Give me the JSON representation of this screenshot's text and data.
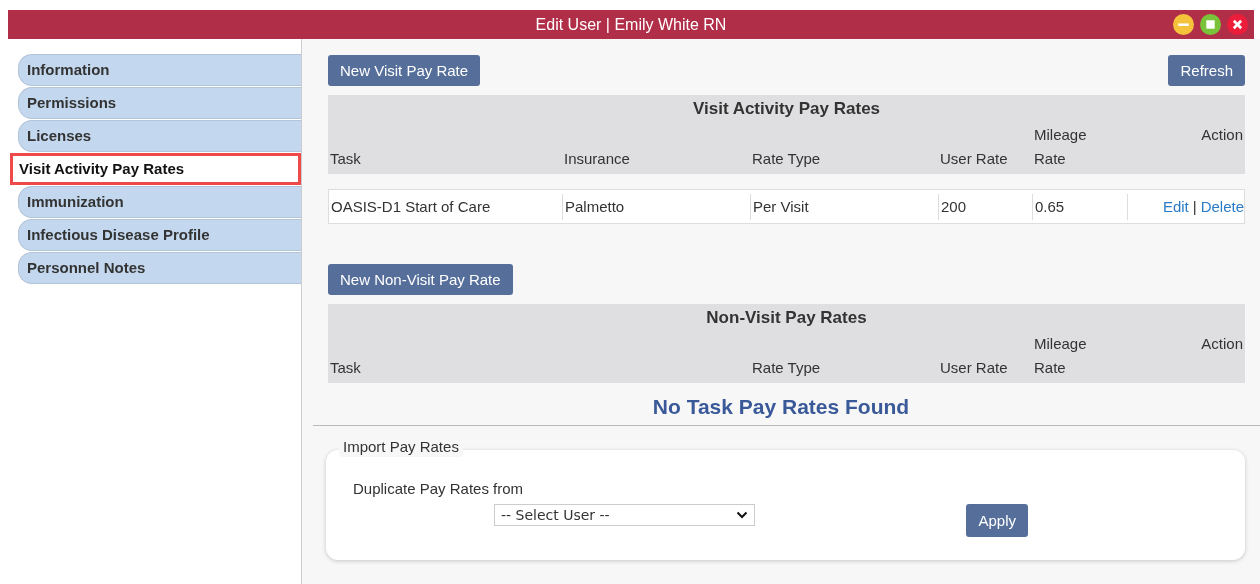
{
  "window": {
    "title": "Edit User | Emily White RN"
  },
  "sidebar": {
    "items": [
      {
        "label": "Information",
        "selected": false
      },
      {
        "label": "Permissions",
        "selected": false
      },
      {
        "label": "Licenses",
        "selected": false
      },
      {
        "label": "Visit Activity Pay Rates",
        "selected": true
      },
      {
        "label": "Immunization",
        "selected": false
      },
      {
        "label": "Infectious Disease Profile",
        "selected": false
      },
      {
        "label": "Personnel Notes",
        "selected": false
      }
    ]
  },
  "toolbar": {
    "new_button": "New Visit Pay Rate",
    "refresh_button": "Refresh"
  },
  "visit_table": {
    "title": "Visit Activity Pay Rates",
    "columns": [
      {
        "label": "Task",
        "kind": "task"
      },
      {
        "label": "Insurance",
        "kind": "insurance"
      },
      {
        "label": "Rate Type",
        "kind": "rate_type"
      },
      {
        "label": "User Rate",
        "kind": "user_rate"
      },
      {
        "label": "Mileage Rate",
        "kind": "mileage"
      },
      {
        "label": "Action",
        "kind": "action"
      }
    ],
    "rows": [
      {
        "cells": [
          "OASIS-D1 Start of Care",
          "Palmetto",
          "Per Visit",
          "200",
          "0.65"
        ],
        "actions": [
          "Edit",
          "Delete"
        ]
      }
    ],
    "action_separator": "|"
  },
  "non_visit_button": "New Non-Visit Pay Rate",
  "non_visit_table": {
    "title": "Non-Visit Pay Rates",
    "columns": [
      {
        "label": "Task",
        "kind": "task_wide"
      },
      {
        "label": "Rate Type",
        "kind": "rate_type"
      },
      {
        "label": "User Rate",
        "kind": "user_rate"
      },
      {
        "label": "Mileage Rate",
        "kind": "mileage"
      },
      {
        "label": "Action",
        "kind": "action"
      }
    ],
    "empty_message": "No Task Pay Rates Found"
  },
  "import": {
    "legend": "Import Pay Rates",
    "label": "Duplicate Pay Rates from",
    "select_value": "-- Select User --",
    "apply_button": "Apply"
  }
}
